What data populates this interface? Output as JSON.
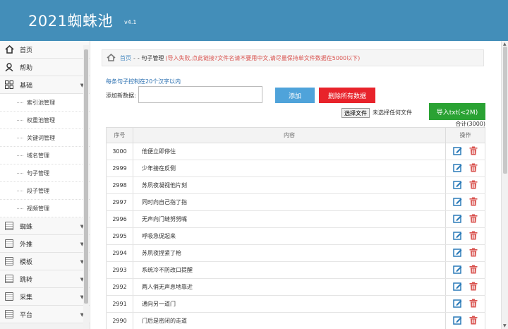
{
  "header": {
    "title": "2021蜘蛛池",
    "version": "v4.1"
  },
  "sidebar": {
    "items": [
      {
        "key": "home",
        "label": "首页",
        "icon": "home-icon"
      },
      {
        "key": "help",
        "label": "帮助",
        "icon": "user-icon"
      },
      {
        "key": "basic",
        "label": "基础",
        "icon": "grid-icon"
      }
    ],
    "sub_items": [
      "索引池管理",
      "权重池管理",
      "关键词管理",
      "域名管理",
      "句子管理",
      "段子管理",
      "视频管理"
    ],
    "more_items": [
      "蜘蛛",
      "外推",
      "模板",
      "跳转",
      "采集",
      "平台"
    ]
  },
  "breadcrumb": {
    "home": "首页",
    "sep": "-",
    "current": "- 句子管理",
    "note": "(导入失败,点此链接?文件名请不要用中文,请尽量保持单文件数据在5000以下)"
  },
  "form": {
    "hint": "每条句子控制在20个汉字以内",
    "add_label": "添加新数据:",
    "add_value": "",
    "add_button": "添加",
    "delete_all_button": "删除所有数据",
    "file_button": "选择文件",
    "file_status": "未选择任何文件",
    "import_button": "导入txt(<2M)",
    "total": "合计(3000)"
  },
  "table": {
    "headers": [
      "序号",
      "内容",
      "操作"
    ],
    "rows": [
      {
        "id": "3000",
        "text": "他便立即停住"
      },
      {
        "id": "2999",
        "text": "少年接在反侧"
      },
      {
        "id": "2998",
        "text": "苏夙夜凝视他片刻"
      },
      {
        "id": "2997",
        "text": "同时向自己指了指"
      },
      {
        "id": "2996",
        "text": "无声向门缝努努嘴"
      },
      {
        "id": "2995",
        "text": "呼吸急促起来"
      },
      {
        "id": "2994",
        "text": "苏夙夜捏紧了枪"
      },
      {
        "id": "2993",
        "text": "系统冷不防改口提醒"
      },
      {
        "id": "2992",
        "text": "两人俏无声息地靠近"
      },
      {
        "id": "2991",
        "text": "通向另一道门"
      },
      {
        "id": "2990",
        "text": "门后是密闭的走道"
      }
    ]
  },
  "colors": {
    "header": "#438eb9",
    "add": "#4fa3da",
    "delete": "#e8232b",
    "import": "#2aa233",
    "edit_icon": "#2a7ab8",
    "trash_icon": "#d9534f"
  }
}
